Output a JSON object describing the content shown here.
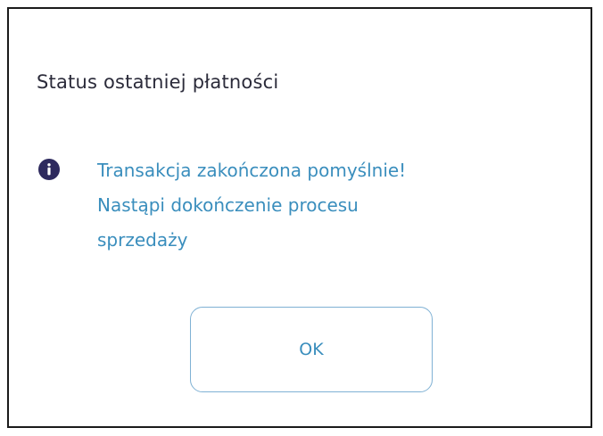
{
  "dialog": {
    "title": "Status ostatniej płatności",
    "info_icon": "info-icon",
    "message_lines": [
      "Transakcja zakończona pomyślnie!",
      "Nastąpi dokończenie procesu",
      "sprzedaży"
    ],
    "ok_label": "OK"
  },
  "colors": {
    "title_text": "#2b2b3a",
    "message_text": "#3a8ebd",
    "icon_fill": "#2e2a5e",
    "button_border": "#7fb1d4",
    "dialog_border": "#1b1b1b"
  }
}
